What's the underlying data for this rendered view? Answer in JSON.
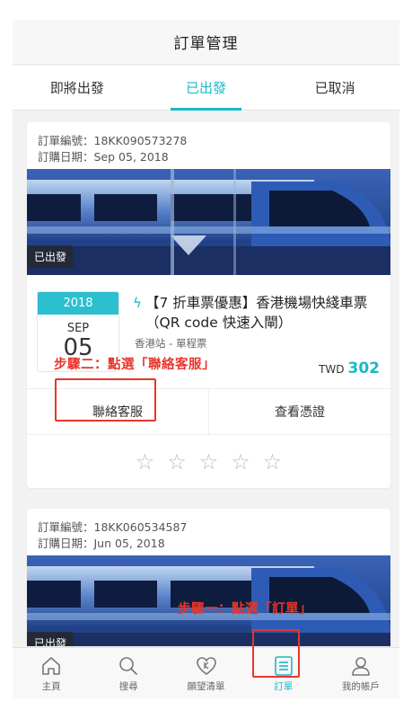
{
  "header": {
    "title": "訂單管理"
  },
  "tabs": [
    {
      "label": "即將出發"
    },
    {
      "label": "已出發"
    },
    {
      "label": "已取消"
    }
  ],
  "orders": [
    {
      "order_no": "訂單編號：18KK090573278",
      "order_date": "訂購日期：Sep 05, 2018",
      "status": "已出發",
      "date": {
        "year": "2018",
        "month": "SEP",
        "day": "05"
      },
      "title": "【7 折車票優惠】香港機場快綫車票（QR code 快速入閘）",
      "subtitle": "香港站 - 單程票",
      "currency": "TWD",
      "price": "302",
      "actions": {
        "contact": "聯絡客服",
        "voucher": "查看憑證"
      },
      "rating_stars": 5
    },
    {
      "order_no": "訂單編號：18KK060534587",
      "order_date": "訂購日期：Jun 05, 2018",
      "status": "已出發"
    }
  ],
  "annotations": {
    "step1": "步驟一：點選「訂單」",
    "step2": "步驟二：點選「聯絡客服」"
  },
  "tabbar": [
    {
      "label": "主頁",
      "icon": "home-icon"
    },
    {
      "label": "搜尋",
      "icon": "search-icon"
    },
    {
      "label": "願望清單",
      "icon": "wishlist-heart-icon"
    },
    {
      "label": "訂單",
      "icon": "order-list-icon"
    },
    {
      "label": "我的帳戶",
      "icon": "account-icon"
    }
  ],
  "colors": {
    "accent": "#19b8c9",
    "annotation": "#e8352b"
  }
}
